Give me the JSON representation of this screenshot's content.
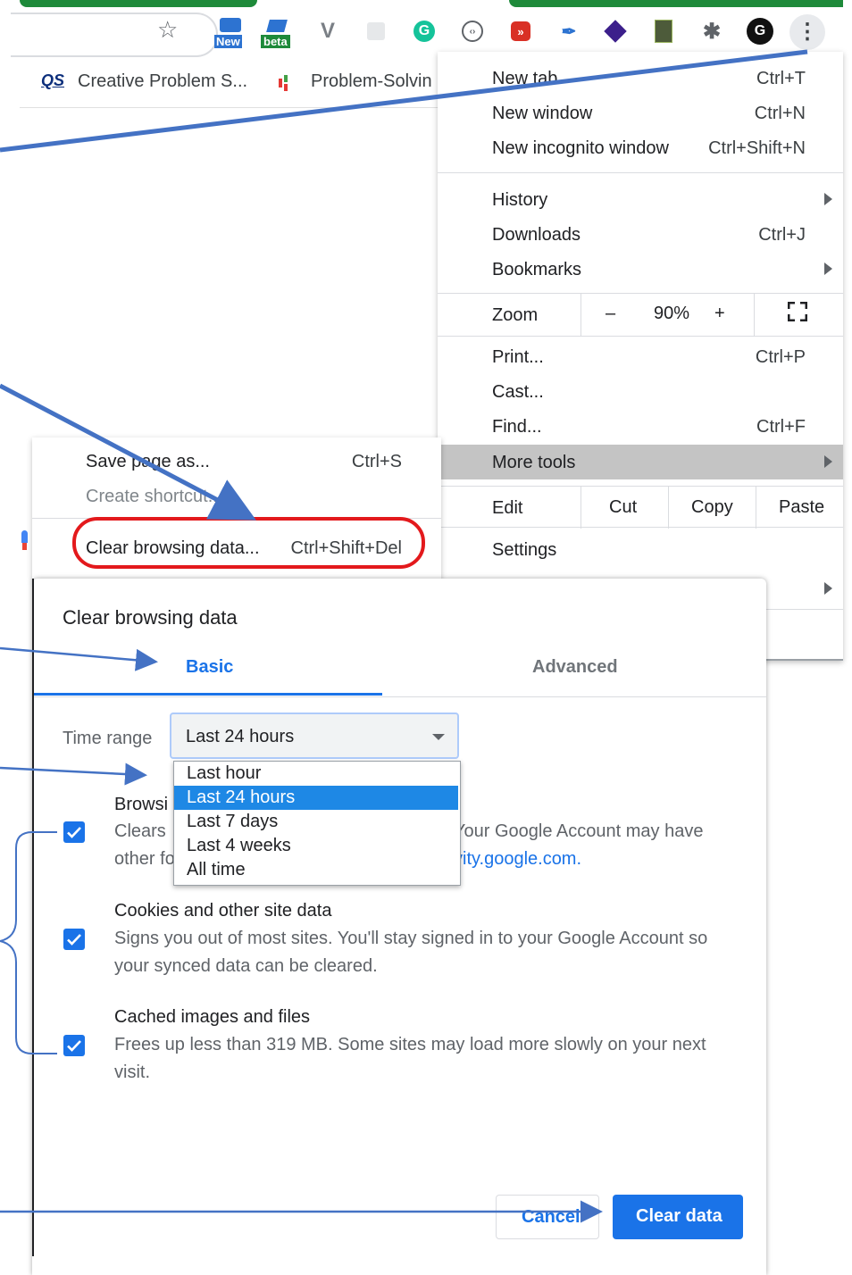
{
  "toolbar": {
    "ext_new_label": "New",
    "ext_beta_label": "beta",
    "ext_v_glyph": "V",
    "ext_g_glyph": "G",
    "ext_avatar_glyph": "G"
  },
  "bookmarks": [
    {
      "icon": "QS",
      "label": "Creative Problem S..."
    },
    {
      "label": "Problem-Solvin"
    }
  ],
  "main_menu": {
    "items_top": [
      {
        "label": "New tab",
        "shortcut": "Ctrl+T"
      },
      {
        "label": "New window",
        "shortcut": "Ctrl+N"
      },
      {
        "label": "New incognito window",
        "shortcut": "Ctrl+Shift+N"
      }
    ],
    "items_mid": [
      {
        "label": "History",
        "shortcut": ""
      },
      {
        "label": "Downloads",
        "shortcut": "Ctrl+J"
      },
      {
        "label": "Bookmarks",
        "shortcut": ""
      }
    ],
    "zoom": {
      "label": "Zoom",
      "minus": "–",
      "value": "90%",
      "plus": "+"
    },
    "items_tools": [
      {
        "label": "Print...",
        "shortcut": "Ctrl+P"
      },
      {
        "label": "Cast...",
        "shortcut": ""
      },
      {
        "label": "Find...",
        "shortcut": "Ctrl+F"
      },
      {
        "label": "More tools",
        "shortcut": ""
      }
    ],
    "edit": {
      "label": "Edit",
      "cut": "Cut",
      "copy": "Copy",
      "paste": "Paste"
    },
    "settings": "Settings"
  },
  "more_tools": {
    "items": [
      {
        "label": "Save page as...",
        "shortcut": "Ctrl+S"
      },
      {
        "label": "Create shortcut...",
        "shortcut": ""
      },
      {
        "label": "Clear browsing data...",
        "shortcut": "Ctrl+Shift+Del"
      }
    ]
  },
  "dialog": {
    "title": "Clear browsing data",
    "tabs": {
      "basic": "Basic",
      "advanced": "Advanced"
    },
    "time_range_label": "Time range",
    "time_range_value": "Last 24 hours",
    "time_range_options": [
      "Last hour",
      "Last 24 hours",
      "Last 7 days",
      "Last 4 weeks",
      "All time"
    ],
    "items": [
      {
        "title": "Browsi",
        "desc_line1_start": "Clears",
        "desc_line1_end": "Your Google Account may have",
        "desc_line2_start": "other fo",
        "desc_line2_link": "vity.google.com."
      },
      {
        "title": "Cookies and other site data",
        "desc_line1": "Signs you out of most sites. You'll stay signed in to your Google Account so",
        "desc_line2": "your synced data can be cleared."
      },
      {
        "title": "Cached images and files",
        "desc_line1": "Frees up less than 319 MB. Some sites may load more slowly on your next",
        "desc_line2": "visit."
      }
    ],
    "cancel": "Cancel",
    "clear": "Clear data"
  },
  "colors": {
    "accent": "#1a73e8",
    "annotation_arrow": "#4472c4",
    "highlight_outline": "#e3191c",
    "menu_highlight": "#c4c4c4",
    "dropdown_selected": "#1e88e5"
  }
}
